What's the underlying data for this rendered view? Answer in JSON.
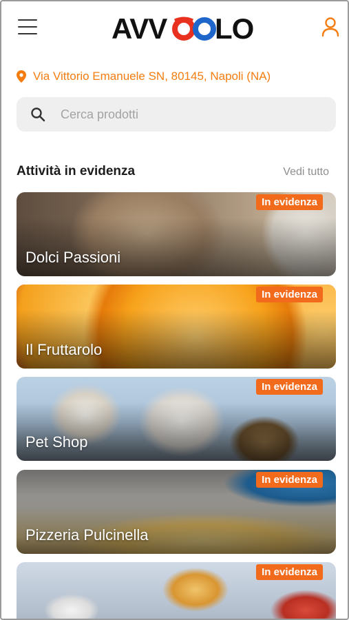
{
  "header": {
    "logo_text": "AVVOOLO",
    "menu_icon": "hamburger-menu-icon",
    "user_icon": "user-icon"
  },
  "address": {
    "icon": "location-pin-icon",
    "text": "Via Vittorio Emanuele SN, 80145, Napoli (NA)"
  },
  "search": {
    "icon": "search-icon",
    "placeholder": "Cerca prodotti",
    "value": ""
  },
  "featured": {
    "title": "Attività in evidenza",
    "see_all": "Vedi tutto",
    "items": [
      {
        "name": "Dolci Passioni",
        "badge": "In evidenza"
      },
      {
        "name": "Il Fruttarolo",
        "badge": "In evidenza"
      },
      {
        "name": "Pet Shop",
        "badge": "In evidenza"
      },
      {
        "name": "Pizzeria Pulcinella",
        "badge": "In evidenza"
      },
      {
        "name": "",
        "badge": "In evidenza"
      }
    ]
  },
  "colors": {
    "accent": "#f57c10",
    "badge": "#f26a1b",
    "search_bg": "#efefef",
    "logo_blue": "#1e66c9",
    "logo_red": "#e8321f"
  }
}
